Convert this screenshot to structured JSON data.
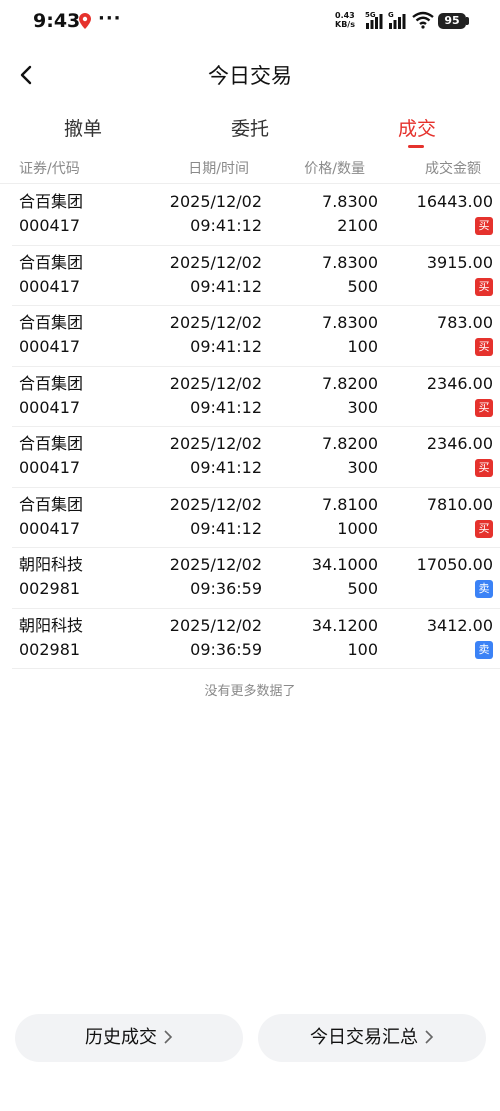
{
  "status_bar": {
    "time": "9:43",
    "speed_line1": "0.43",
    "speed_line2": "KB/s",
    "network": "5G",
    "battery": "95"
  },
  "nav": {
    "title": "今日交易"
  },
  "tabs": [
    {
      "label": "撤单",
      "active": false
    },
    {
      "label": "委托",
      "active": false
    },
    {
      "label": "成交",
      "active": true
    }
  ],
  "table": {
    "headers": [
      "证券/代码",
      "日期/时间",
      "价格/数量",
      "成交金额"
    ],
    "rows": [
      {
        "name": "合百集团",
        "code": "000417",
        "date": "2025/12/02",
        "time": "09:41:12",
        "price": "7.8300",
        "qty": "2100",
        "amount": "16443.00",
        "side": "买"
      },
      {
        "name": "合百集团",
        "code": "000417",
        "date": "2025/12/02",
        "time": "09:41:12",
        "price": "7.8300",
        "qty": "500",
        "amount": "3915.00",
        "side": "买"
      },
      {
        "name": "合百集团",
        "code": "000417",
        "date": "2025/12/02",
        "time": "09:41:12",
        "price": "7.8300",
        "qty": "100",
        "amount": "783.00",
        "side": "买"
      },
      {
        "name": "合百集团",
        "code": "000417",
        "date": "2025/12/02",
        "time": "09:41:12",
        "price": "7.8200",
        "qty": "300",
        "amount": "2346.00",
        "side": "买"
      },
      {
        "name": "合百集团",
        "code": "000417",
        "date": "2025/12/02",
        "time": "09:41:12",
        "price": "7.8200",
        "qty": "300",
        "amount": "2346.00",
        "side": "买"
      },
      {
        "name": "合百集团",
        "code": "000417",
        "date": "2025/12/02",
        "time": "09:41:12",
        "price": "7.8100",
        "qty": "1000",
        "amount": "7810.00",
        "side": "买"
      },
      {
        "name": "朝阳科技",
        "code": "002981",
        "date": "2025/12/02",
        "time": "09:36:59",
        "price": "34.1000",
        "qty": "500",
        "amount": "17050.00",
        "side": "卖"
      },
      {
        "name": "朝阳科技",
        "code": "002981",
        "date": "2025/12/02",
        "time": "09:36:59",
        "price": "34.1200",
        "qty": "100",
        "amount": "3412.00",
        "side": "卖"
      }
    ]
  },
  "no_more_text": "没有更多数据了",
  "buttons": {
    "history": "历史成交",
    "summary": "今日交易汇总"
  },
  "colors": {
    "accent_red": "#e5322d",
    "buy_badge": "#e5322d",
    "sell_badge": "#3b82f6"
  },
  "icons": {
    "back": "chevron-left-icon",
    "location": "location-pin-icon",
    "more": "more-dots-icon",
    "signal": "signal-icon",
    "wifi": "wifi-icon",
    "battery": "battery-icon",
    "chevron_right": "chevron-right-icon"
  }
}
